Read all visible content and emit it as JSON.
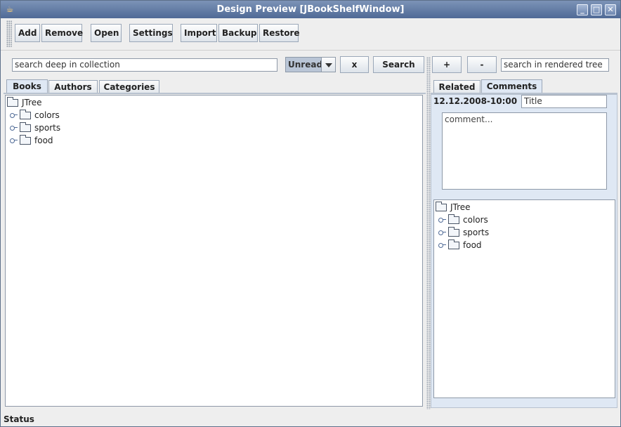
{
  "window": {
    "title": "Design Preview [JBookShelfWindow]",
    "buttons": [
      "minimize",
      "maximize",
      "close"
    ]
  },
  "toolbar": {
    "add": "Add",
    "remove": "Remove",
    "open": "Open",
    "settings": "Settings",
    "import": "Import",
    "backup": "Backup",
    "restore": "Restore"
  },
  "left": {
    "search_placeholder": "search deep in collection",
    "filter_selected": "Unread",
    "clear_label": "x",
    "search_label": "Search",
    "tabs": [
      "Books",
      "Authors",
      "Categories"
    ],
    "tree": {
      "root": "JTree",
      "children": [
        "colors",
        "sports",
        "food"
      ]
    }
  },
  "right": {
    "add_label": "+",
    "remove_label": "-",
    "search_placeholder": "search in rendered tree",
    "tabs": [
      "Related",
      "Comments"
    ],
    "comment_date": "12.12.2008-10:00",
    "title_value": "Title",
    "comment_placeholder": "comment...",
    "tree": {
      "root": "JTree",
      "children": [
        "colors",
        "sports",
        "food"
      ]
    }
  },
  "status": "Status",
  "icons": {
    "app": "java-cup-icon",
    "folder": "folder-icon",
    "expand": "expand-handle-icon"
  }
}
